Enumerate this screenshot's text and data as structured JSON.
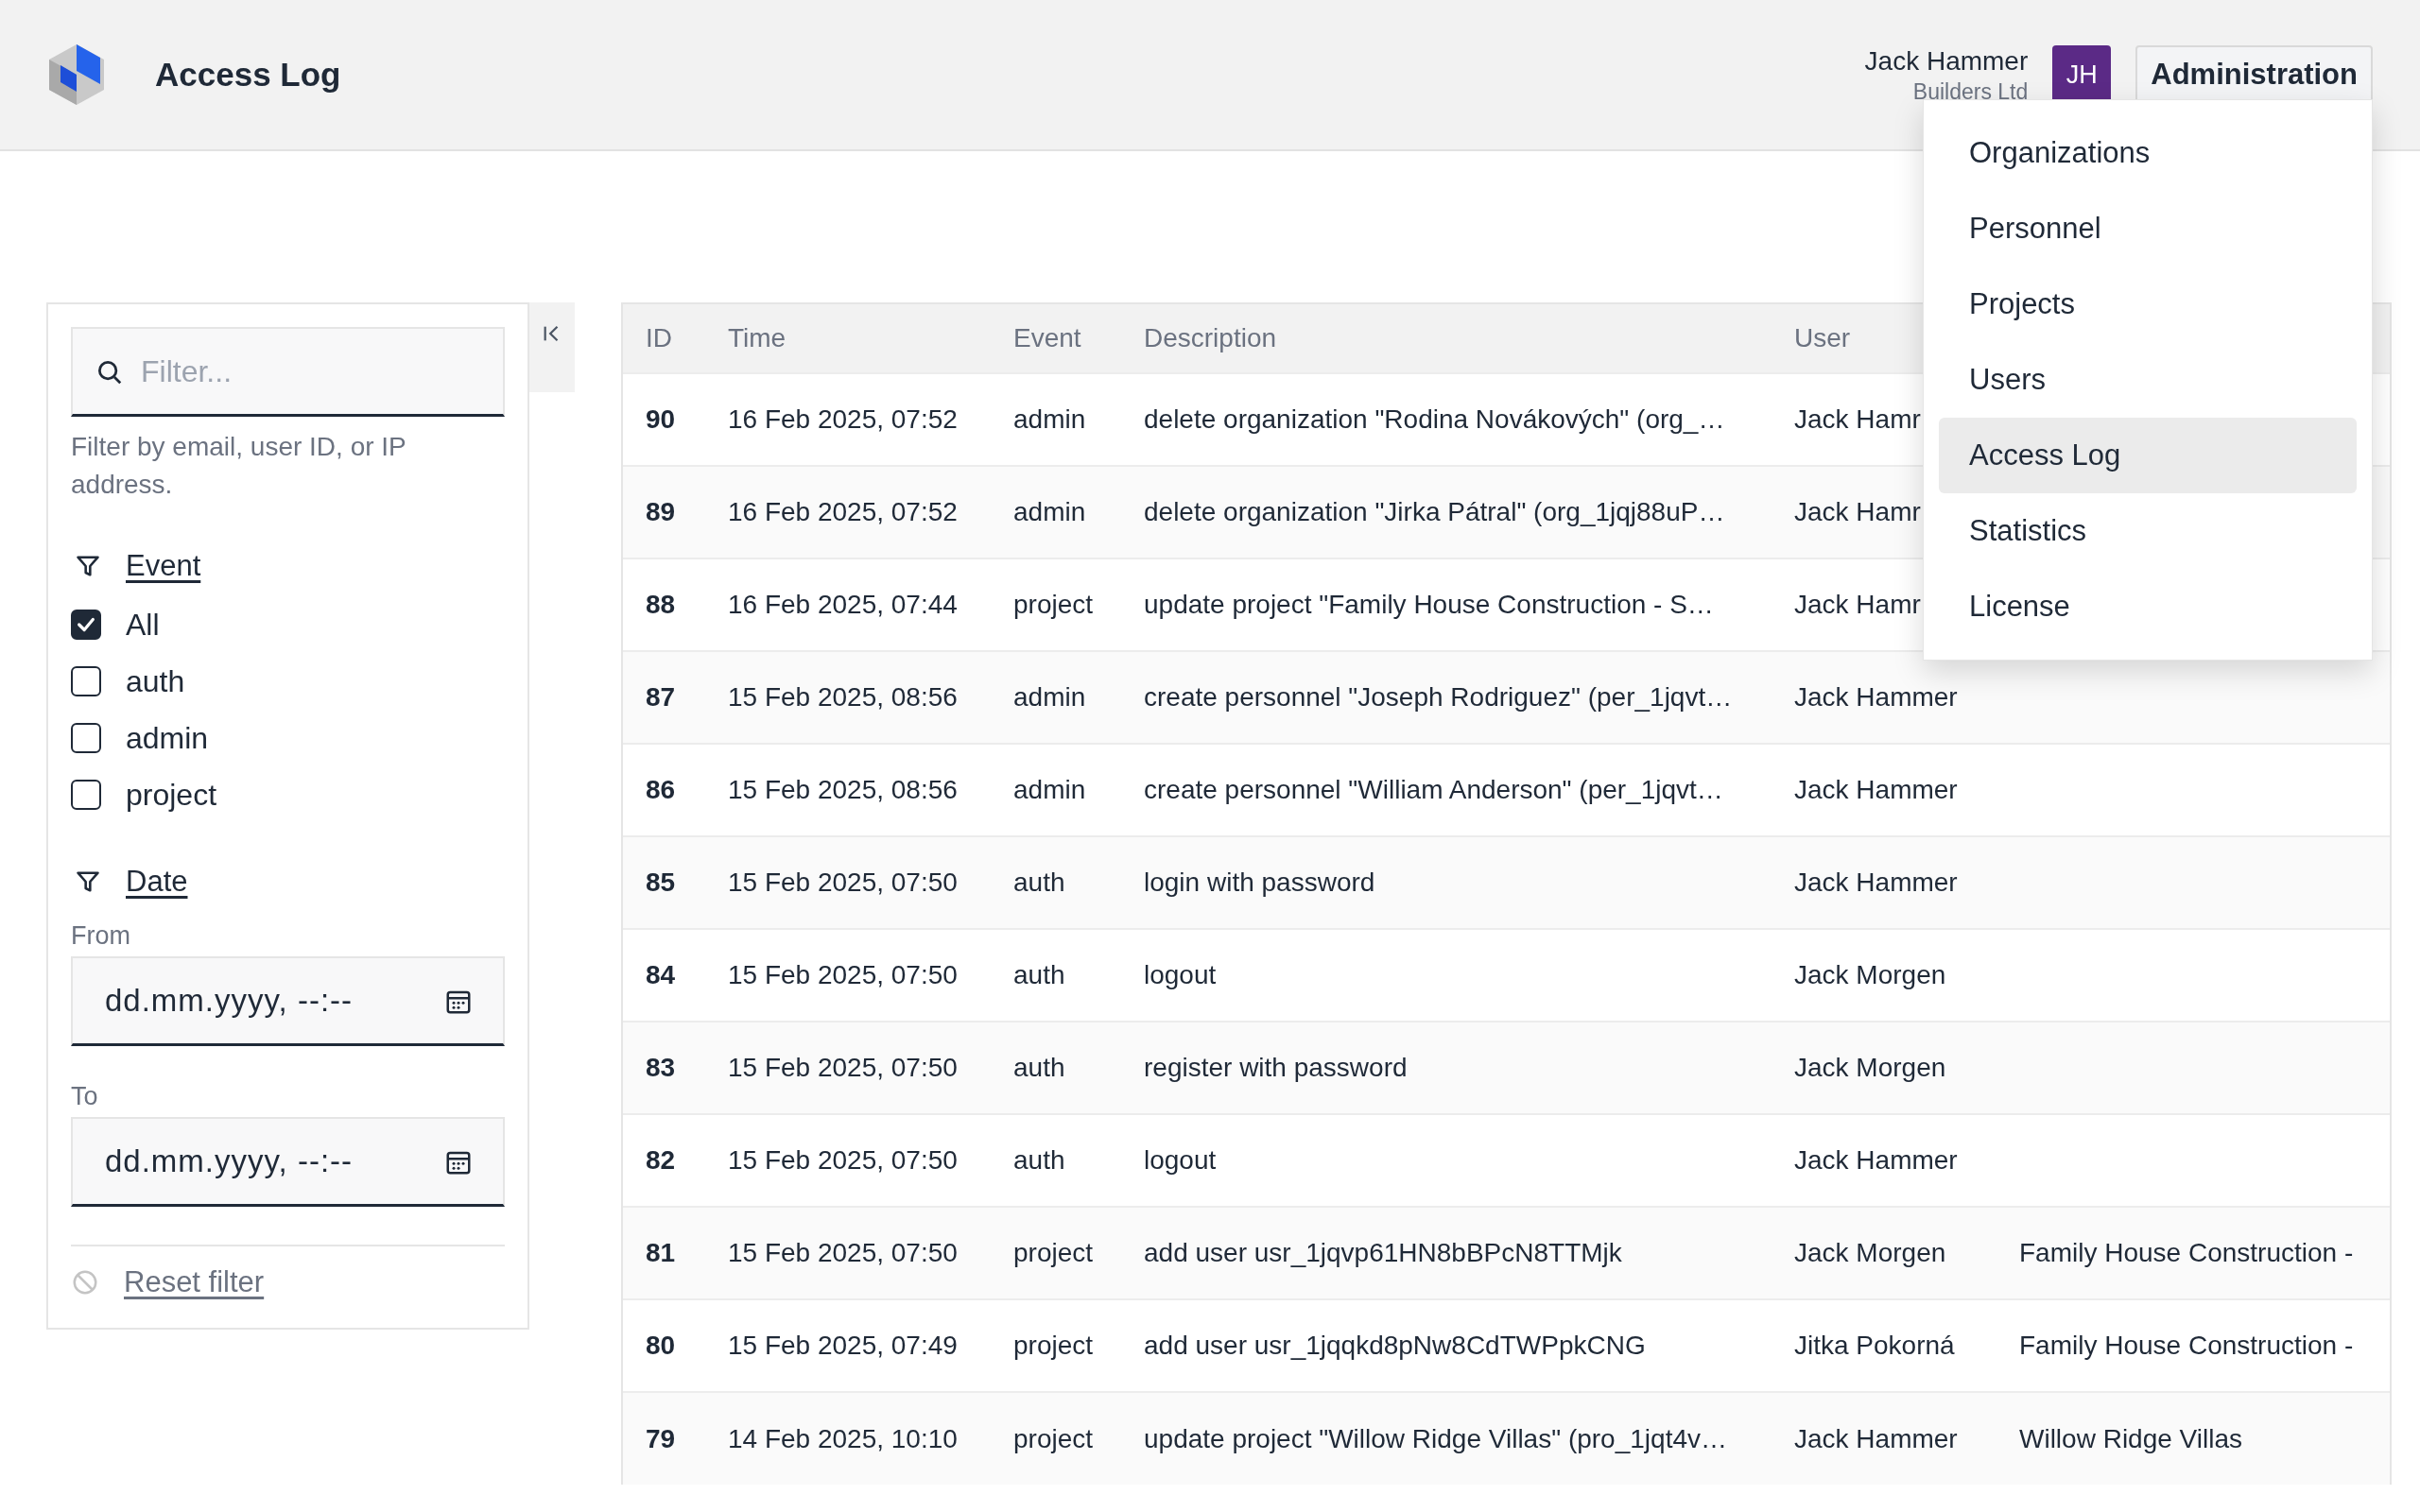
{
  "header": {
    "title": "Access Log",
    "user": {
      "name": "Jack Hammer",
      "org": "Builders Ltd",
      "initials": "JH"
    },
    "menu_button": "Administration"
  },
  "menu": {
    "items": [
      {
        "label": "Organizations",
        "selected": false
      },
      {
        "label": "Personnel",
        "selected": false
      },
      {
        "label": "Projects",
        "selected": false
      },
      {
        "label": "Users",
        "selected": false
      },
      {
        "label": "Access Log",
        "selected": true
      },
      {
        "label": "Statistics",
        "selected": false
      },
      {
        "label": "License",
        "selected": false
      }
    ]
  },
  "sidebar": {
    "search": {
      "placeholder": "Filter...",
      "help": "Filter by email, user ID, or IP address."
    },
    "event_filter": {
      "title": "Event",
      "options": [
        {
          "label": "All",
          "checked": true
        },
        {
          "label": "auth",
          "checked": false
        },
        {
          "label": "admin",
          "checked": false
        },
        {
          "label": "project",
          "checked": false
        }
      ]
    },
    "date_filter": {
      "title": "Date",
      "fields": [
        {
          "label": "From",
          "placeholder": "dd.mm.yyyy, --:--"
        },
        {
          "label": "To",
          "placeholder": "dd.mm.yyyy, --:--"
        }
      ]
    },
    "reset": "Reset filter"
  },
  "table": {
    "columns": [
      "ID",
      "Time",
      "Event",
      "Description",
      "User"
    ],
    "rows": [
      {
        "id": "90",
        "time": "16 Feb 2025, 07:52",
        "event": "admin",
        "description": "delete organization \"Rodina Novákových\" (org_…",
        "user": "Jack Hamr"
      },
      {
        "id": "89",
        "time": "16 Feb 2025, 07:52",
        "event": "admin",
        "description": "delete organization \"Jirka Pátral\" (org_1jqj88uP…",
        "user": "Jack Hamr"
      },
      {
        "id": "88",
        "time": "16 Feb 2025, 07:44",
        "event": "project",
        "description": "update project \"Family House Construction - S…",
        "user": "Jack Hamr"
      },
      {
        "id": "87",
        "time": "15 Feb 2025, 08:56",
        "event": "admin",
        "description": "create personnel \"Joseph Rodriguez\" (per_1jqvt…",
        "user": "Jack Hammer"
      },
      {
        "id": "86",
        "time": "15 Feb 2025, 08:56",
        "event": "admin",
        "description": "create personnel \"William Anderson\" (per_1jqvt…",
        "user": "Jack Hammer"
      },
      {
        "id": "85",
        "time": "15 Feb 2025, 07:50",
        "event": "auth",
        "description": "login with password",
        "user": "Jack Hammer"
      },
      {
        "id": "84",
        "time": "15 Feb 2025, 07:50",
        "event": "auth",
        "description": "logout",
        "user": "Jack Morgen"
      },
      {
        "id": "83",
        "time": "15 Feb 2025, 07:50",
        "event": "auth",
        "description": "register with password",
        "user": "Jack Morgen"
      },
      {
        "id": "82",
        "time": "15 Feb 2025, 07:50",
        "event": "auth",
        "description": "logout",
        "user": "Jack Hammer"
      },
      {
        "id": "81",
        "time": "15 Feb 2025, 07:50",
        "event": "project",
        "description": "add user usr_1jqvp61HN8bBPcN8TTMjk",
        "user": "Jack Morgen",
        "column_6": "Family House Construction -"
      },
      {
        "id": "80",
        "time": "15 Feb 2025, 07:49",
        "event": "project",
        "description": "add user usr_1jqqkd8pNw8CdTWPpkCNG",
        "user": "Jitka Pokorná",
        "column_6": "Family House Construction -"
      },
      {
        "id": "79",
        "time": "14 Feb 2025, 10:10",
        "event": "project",
        "description": "update project \"Willow Ridge Villas\" (pro_1jqt4v…",
        "user": "Jack Hammer",
        "column_6": "Willow Ridge Villas"
      }
    ]
  }
}
